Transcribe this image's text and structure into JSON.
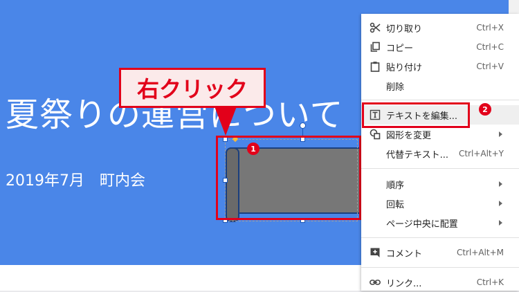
{
  "slide": {
    "title": "夏祭りの運営について",
    "subtitle": "2019年7月　町内会"
  },
  "callout": {
    "text": "右クリック"
  },
  "badges": {
    "one": "1",
    "two": "2"
  },
  "context_menu": {
    "items": [
      {
        "icon": "scissors-icon",
        "label": "切り取り",
        "shortcut": "Ctrl+X"
      },
      {
        "icon": "copy-icon",
        "label": "コピー",
        "shortcut": "Ctrl+C"
      },
      {
        "icon": "clipboard-icon",
        "label": "貼り付け",
        "shortcut": "Ctrl+V"
      },
      {
        "icon": "",
        "label": "削除",
        "shortcut": ""
      },
      {
        "icon": "edit-text-icon",
        "label": "テキストを編集...",
        "shortcut": ""
      },
      {
        "icon": "change-shape-icon",
        "label": "図形を変更",
        "shortcut": ""
      },
      {
        "icon": "",
        "label": "代替テキスト...",
        "shortcut": "Ctrl+Alt+Y"
      },
      {
        "icon": "",
        "label": "順序",
        "shortcut": ""
      },
      {
        "icon": "",
        "label": "回転",
        "shortcut": ""
      },
      {
        "icon": "",
        "label": "ページ中央に配置",
        "shortcut": ""
      },
      {
        "icon": "add-comment-icon",
        "label": "コメント",
        "shortcut": "Ctrl+Alt+M"
      },
      {
        "icon": "link-icon",
        "label": "リンク...",
        "shortcut": "Ctrl+K"
      }
    ]
  },
  "colors": {
    "slide_background": "#4a86e8",
    "highlight_red": "#e2001a",
    "shape_fill": "#777777"
  }
}
